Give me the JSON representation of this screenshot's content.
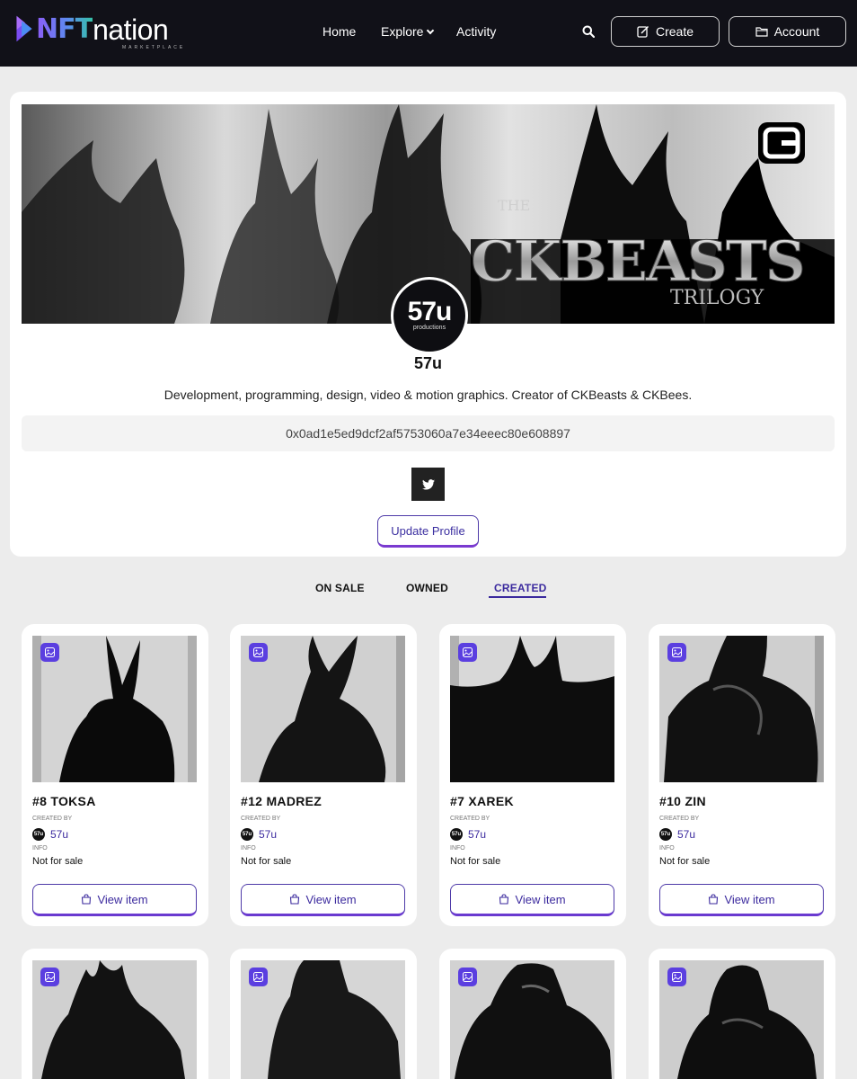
{
  "nav": {
    "logo_nft": "NFT",
    "logo_nation": "nation",
    "logo_sub": "MARKETPLACE",
    "home": "Home",
    "explore": "Explore",
    "activity": "Activity",
    "create": "Create",
    "account": "Account"
  },
  "profile": {
    "avatar_main": "57u",
    "avatar_sub": "productions",
    "username": "57u",
    "bio": "Development, programming, design, video & motion graphics. Creator of CKBeasts & CKBees.",
    "address": "0x0ad1e5ed9dcf2af5753060a7e34eeec80e608897",
    "update_button": "Update Profile",
    "banner": {
      "the": "THE",
      "title": "CKBEASTS",
      "subtitle": "TRILOGY"
    }
  },
  "tabs": {
    "on_sale": "ON SALE",
    "owned": "OWNED",
    "created": "CREATED",
    "active": "CREATED"
  },
  "cards": [
    {
      "title": "#8 TOKSA",
      "created_by_label": "CREATED BY",
      "creator": "57u",
      "creator_avatar": "57u",
      "info_label": "INFO",
      "status": "Not for sale",
      "button": "View item"
    },
    {
      "title": "#12 MADREZ",
      "created_by_label": "CREATED BY",
      "creator": "57u",
      "creator_avatar": "57u",
      "info_label": "INFO",
      "status": "Not for sale",
      "button": "View item"
    },
    {
      "title": "#7 XAREK",
      "created_by_label": "CREATED BY",
      "creator": "57u",
      "creator_avatar": "57u",
      "info_label": "INFO",
      "status": "Not for sale",
      "button": "View item"
    },
    {
      "title": "#10 ZIN",
      "created_by_label": "CREATED BY",
      "creator": "57u",
      "creator_avatar": "57u",
      "info_label": "INFO",
      "status": "Not for sale",
      "button": "View item"
    }
  ],
  "colors": {
    "navbar_bg": "#111118",
    "accent": "#3b2a9e",
    "badge": "#5b3fe0"
  },
  "icons": [
    "search-icon",
    "edit-icon",
    "folder-icon",
    "twitter-icon",
    "image-icon",
    "shopping-bag-icon",
    "chevron-down-icon"
  ]
}
